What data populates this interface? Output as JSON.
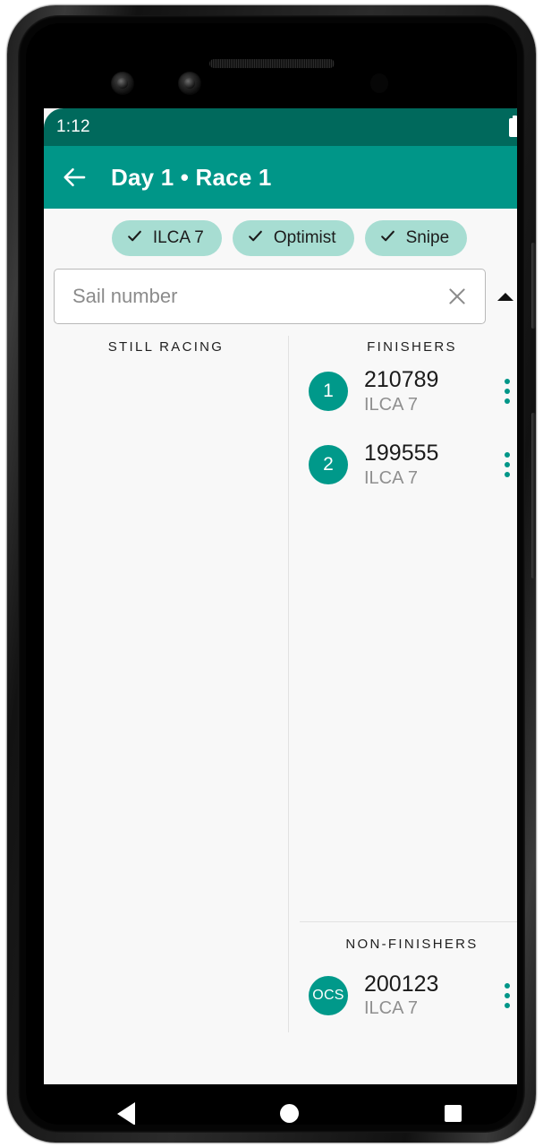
{
  "status_bar": {
    "time": "1:12",
    "battery_icon": "battery-full-icon"
  },
  "app_bar": {
    "back_icon": "back-arrow-icon",
    "title": "Day 1 • Race 1"
  },
  "filter_chips": [
    {
      "label": "ILCA 7",
      "icon": "check-icon",
      "selected": true
    },
    {
      "label": "Optimist",
      "icon": "check-icon",
      "selected": true
    },
    {
      "label": "Snipe",
      "icon": "check-icon",
      "selected": true
    }
  ],
  "search": {
    "value": "",
    "placeholder": "Sail number",
    "clear_icon": "close-x-icon",
    "collapse_icon": "triangle-up-icon"
  },
  "columns": {
    "left_header": "STILL RACING",
    "right_header": "FINISHERS",
    "still_racing_entries": []
  },
  "finishers": [
    {
      "rank": "1",
      "sail_number": "210789",
      "boat_class": "ILCA 7",
      "menu_icon": "more-vertical-icon"
    },
    {
      "rank": "2",
      "sail_number": "199555",
      "boat_class": "ILCA 7",
      "menu_icon": "more-vertical-icon"
    }
  ],
  "non_finishers_section": {
    "header": "NON-FINISHERS",
    "entries": [
      {
        "rank": "OCS",
        "sail_number": "200123",
        "boat_class": "ILCA 7",
        "menu_icon": "more-vertical-icon"
      }
    ]
  },
  "nav_bar": {
    "back": "nav-back-icon",
    "home": "nav-home-icon",
    "recents": "nav-recents-icon"
  },
  "colors": {
    "status_bar": "#00695c",
    "app_bar": "#009688",
    "chip_background": "#a7ddd2",
    "avatar": "#00998a",
    "accent": "#009688",
    "screen_background": "#f8f8f8"
  }
}
